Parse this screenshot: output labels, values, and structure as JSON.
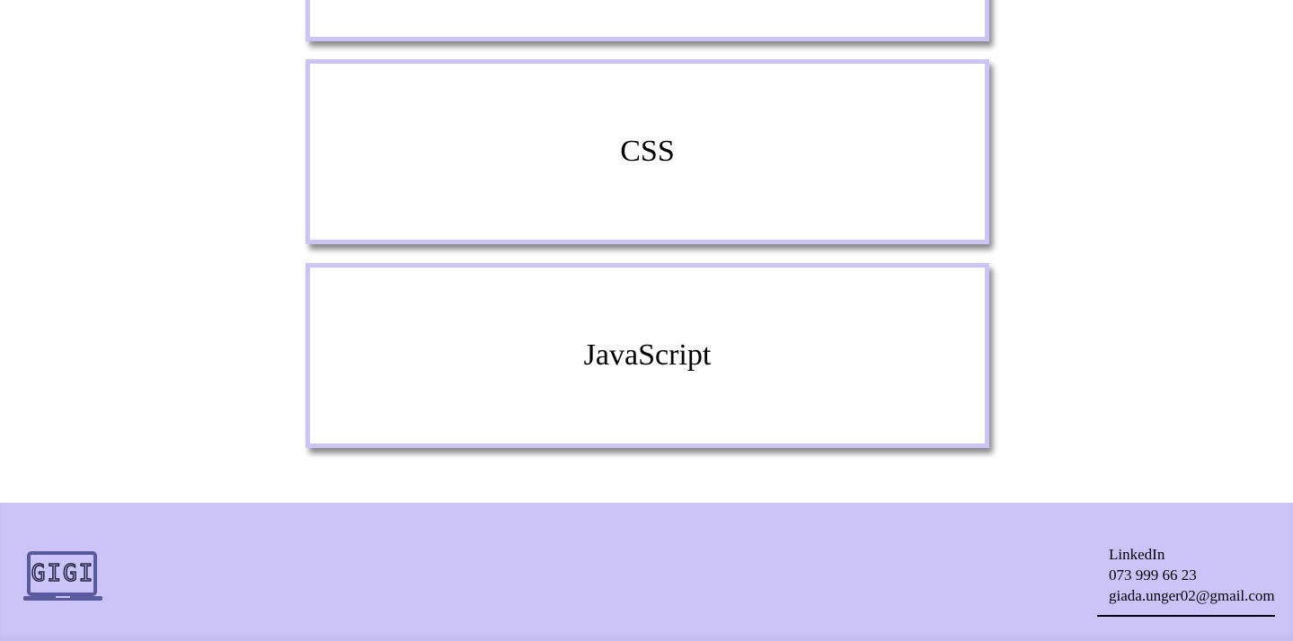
{
  "cards": [
    {
      "label": ""
    },
    {
      "label": "CSS"
    },
    {
      "label": "JavaScript"
    }
  ],
  "footer": {
    "logo_text": "GIGI",
    "logo_icon": "laptop-icon",
    "contact": {
      "linkedin": "LinkedIn",
      "phone": "073 999 66 23",
      "email": "giada.unger02@gmail.com"
    }
  },
  "colors": {
    "accent": "#ccc4f9",
    "logo": "#5a5a9e",
    "background": "#ffffff"
  }
}
